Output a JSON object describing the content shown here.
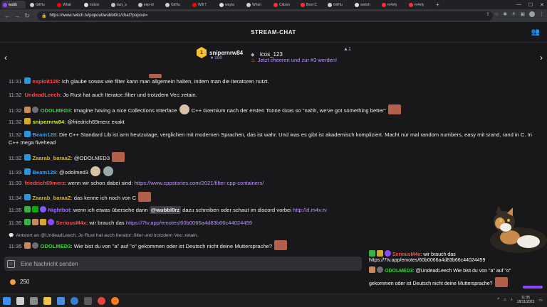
{
  "browser": {
    "tabs": [
      {
        "label": "wubb",
        "color": "#9146ff",
        "active": true
      },
      {
        "label": "GitHu",
        "color": "#d0d0d0"
      },
      {
        "label": "What",
        "color": "#ff0000"
      },
      {
        "label": "Indexi",
        "color": "#e0e0e0"
      },
      {
        "label": "lazy_s",
        "color": "#c0c0c0"
      },
      {
        "label": "esp-id",
        "color": "#c0c0c0"
      },
      {
        "label": "GitHu",
        "color": "#d0d0d0"
      },
      {
        "label": "Will T",
        "color": "#ff0000"
      },
      {
        "label": "wayla",
        "color": "#e0e0e0"
      },
      {
        "label": "When",
        "color": "#d0d0d0"
      },
      {
        "label": "Citizen",
        "color": "#ff3030"
      },
      {
        "label": "Best C",
        "color": "#ff3030"
      },
      {
        "label": "GitHu",
        "color": "#d0d0d0"
      },
      {
        "label": "switch",
        "color": "#e0e0e0"
      },
      {
        "label": "m4xfy",
        "color": "#ff3030"
      },
      {
        "label": "m4xfy",
        "color": "#ff3030"
      }
    ],
    "new_tab": "+",
    "url": "https://www.twitch.tv/popout/wubbl0rz/chat?popout="
  },
  "header": {
    "title": "STREAM-CHAT"
  },
  "leaderboard": {
    "first": {
      "rank": "1",
      "name": "snipernrw84",
      "points": "100"
    },
    "second": {
      "name": "icos_123",
      "rank": "1"
    },
    "cheer_text": "Jetzt cheeren und zur #3 werden!"
  },
  "messages": [
    {
      "time": "11:31",
      "user": "exploit128",
      "user_color": "#ff4a4a",
      "text": "Ich glaube sowas wie filter kann man allgemein halten, indem man die Iteratoren nutzt."
    },
    {
      "time": "11:32",
      "user": "UndeadLeech",
      "user_color": "#ff4a4a",
      "text": "Jo Rust hat auch Iterator::filter und trotzdem Vec::retain."
    },
    {
      "time": "11:32",
      "user": "ODOLMED3",
      "user_color": "#3bd13b",
      "text_a": "Imagine having a nice Collections Interface",
      "text_b": "C++ Gremium nach der ersten Tonne Gras so \"nahh, we've got something better\""
    },
    {
      "time": "11:32",
      "user": "snipernrw84",
      "user_color": "#d6e634",
      "text": "@friedrich69merz exakt"
    },
    {
      "time": "11:32",
      "user": "Beam128",
      "user_color": "#3a9fe6",
      "text": "Die C++ Standard Lib ist arm heutzutage, verglichen mit modernen Sprachen, das ist wahr. Und was es gibt ist akademisch kompliziert. Macht nur mal random numbers, easy mit srand, rand in C. In C++ mega fivehead"
    },
    {
      "time": "11:32",
      "user": "Zaarab_baraaZ",
      "user_color": "#d6b52c",
      "text": "@ODOLMED3"
    },
    {
      "time": "11:33",
      "user": "Beam128",
      "user_color": "#3a9fe6",
      "text": "@odolmed3"
    },
    {
      "time": "11:33",
      "user": "friedrich69merz",
      "user_color": "#ff4a4a",
      "text": "wenn wir schon dabei sind:",
      "link": "https://www.cppstories.com/2021/filter-cpp-containers/"
    },
    {
      "time": "11:34",
      "user": "Zaarab_baraaZ",
      "user_color": "#d6b52c",
      "text": "das kenne ich noch von C"
    },
    {
      "time": "11:35",
      "user": "Nightbot",
      "user_color": "#9d6bff",
      "text_a": "wenn ich etwas übersehe dann",
      "mention": "@wubbl0rz",
      "text_b": "dazu schreiben oder schaut im discord vorbei",
      "link": "http://d.m4x.tv"
    },
    {
      "time": "11:35",
      "user": "SeriousM4x",
      "user_color": "#ff4a4a",
      "text": "wir brauch das",
      "link": "https://7tv.app/emotes/60b0066a4d83b66c44024459"
    },
    {
      "time": "11:35",
      "user": "ODOLMED3",
      "user_color": "#3bd13b",
      "text": "Wie bist du von \"a\" auf \"o\" gekommen oder ist Deutsch nicht deine Muttersprache?"
    }
  ],
  "reply_note": "Antwort an @UndeadLeech: Jo Rust hat auch Iterator::filter und trotzdem Vec::retain.",
  "input": {
    "placeholder": "Eine Nachricht senden"
  },
  "channel_points": "250",
  "overlay": {
    "line1_user": "SeriousM4x",
    "line1_text": "wir brauch das",
    "line2": "https://7tv.app/emotes/60b0066a4d83b66c44024459",
    "line3_user": "ODOLMED3",
    "line3_text": "@UndeadLeech Wie bist du von \"a\" auf \"o\"",
    "line4": "gekommen oder ist Deutsch nicht deine Muttersprache?"
  },
  "taskbar": {
    "time": "11:35",
    "date": "18/11/2023"
  },
  "colors": {
    "accent": "#9146ff",
    "link": "#bf94ff",
    "background": "#18181b"
  }
}
